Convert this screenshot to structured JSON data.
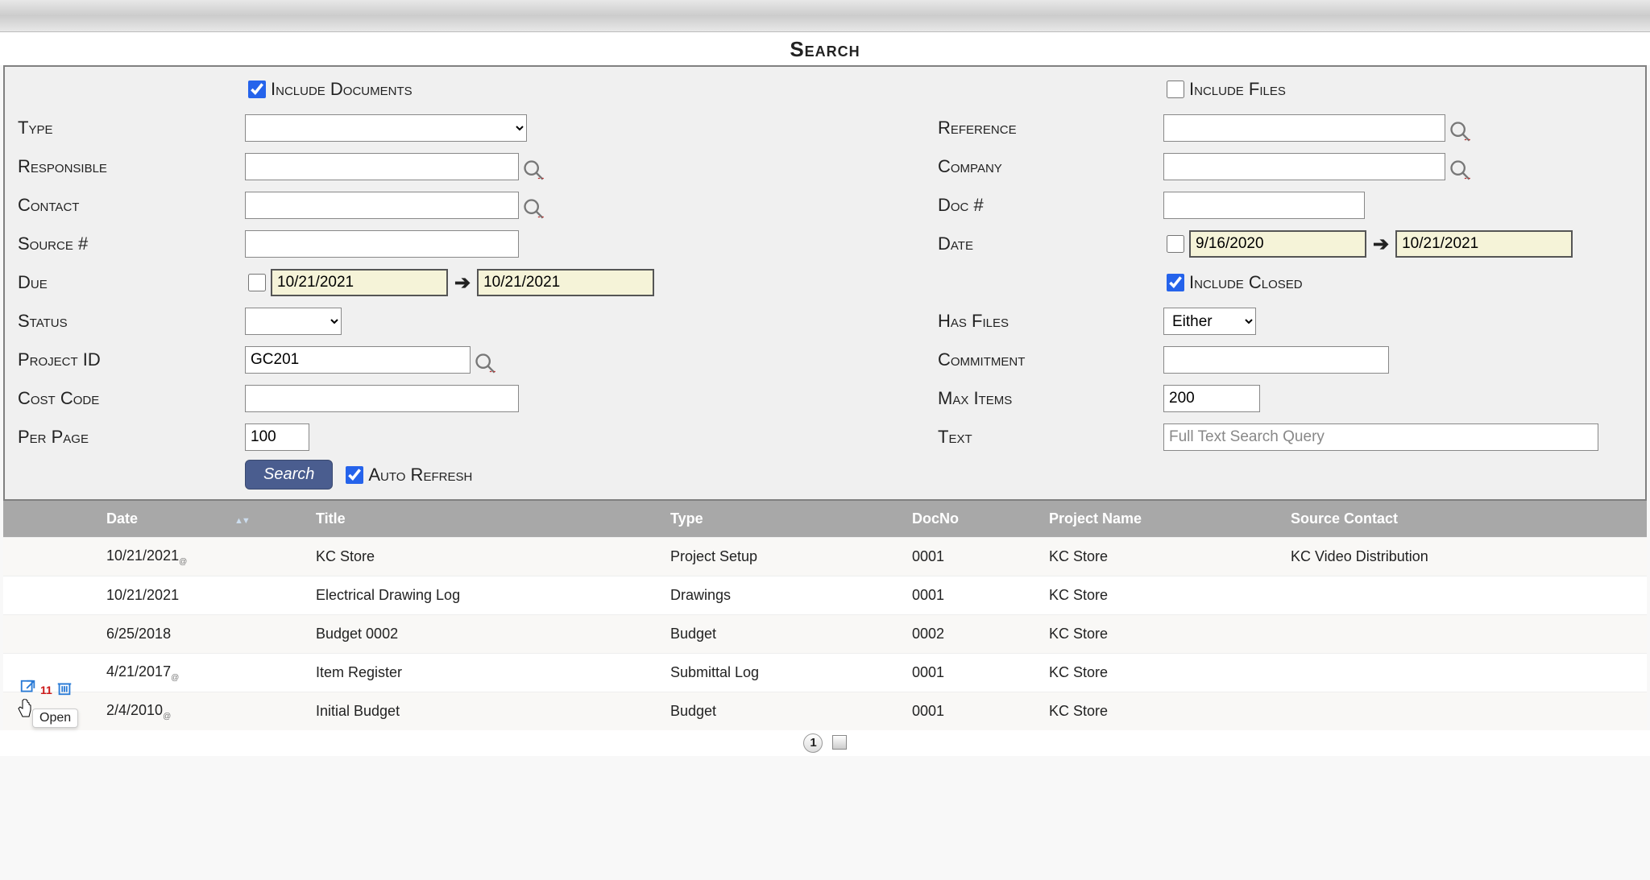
{
  "page": {
    "title": "Search"
  },
  "form": {
    "include_documents": {
      "label": "Include Documents",
      "checked": true
    },
    "include_files": {
      "label": "Include Files",
      "checked": false
    },
    "type": {
      "label": "Type",
      "value": ""
    },
    "reference": {
      "label": "Reference",
      "value": ""
    },
    "responsible": {
      "label": "Responsible",
      "value": ""
    },
    "company": {
      "label": "Company",
      "value": ""
    },
    "contact": {
      "label": "Contact",
      "value": ""
    },
    "doc_no": {
      "label": "Doc #",
      "value": ""
    },
    "source_no": {
      "label": "Source #",
      "value": ""
    },
    "date": {
      "label": "Date",
      "enabled": false,
      "from": "9/16/2020",
      "to": "10/21/2021"
    },
    "due": {
      "label": "Due",
      "enabled": false,
      "from": "10/21/2021",
      "to": "10/21/2021"
    },
    "include_closed": {
      "label": "Include Closed",
      "checked": true
    },
    "status": {
      "label": "Status",
      "value": ""
    },
    "has_files": {
      "label": "Has Files",
      "value": "Either"
    },
    "project_id": {
      "label": "Project ID",
      "value": "GC201"
    },
    "commitment": {
      "label": "Commitment",
      "value": ""
    },
    "cost_code": {
      "label": "Cost Code",
      "value": ""
    },
    "max_items": {
      "label": "Max Items",
      "value": "200"
    },
    "per_page": {
      "label": "Per Page",
      "value": "100"
    },
    "text": {
      "label": "Text",
      "value": "",
      "placeholder": "Full Text Search Query"
    },
    "search_button": "Search",
    "auto_refresh": {
      "label": "Auto Refresh",
      "checked": true
    }
  },
  "results": {
    "columns": {
      "date": "Date",
      "title": "Title",
      "type": "Type",
      "docno": "DocNo",
      "project": "Project Name",
      "contact": "Source Contact"
    },
    "rows": [
      {
        "date": "10/21/2021",
        "has_sub": true,
        "title": "KC Store",
        "type": "Project Setup",
        "docno": "0001",
        "project": "KC Store",
        "contact": "KC Video Distribution"
      },
      {
        "date": "10/21/2021",
        "has_sub": false,
        "title": "Electrical Drawing Log",
        "type": "Drawings",
        "docno": "0001",
        "project": "KC Store",
        "contact": ""
      },
      {
        "date": "6/25/2018",
        "has_sub": false,
        "title": "Budget 0002",
        "type": "Budget",
        "docno": "0002",
        "project": "KC Store",
        "contact": ""
      },
      {
        "date": "4/21/2017",
        "has_sub": true,
        "title": "Item Register",
        "type": "Submittal Log",
        "docno": "0001",
        "project": "KC Store",
        "contact": ""
      },
      {
        "date": "2/4/2010",
        "has_sub": true,
        "title": "Initial Budget",
        "type": "Budget",
        "docno": "0001",
        "project": "KC Store",
        "contact": ""
      }
    ]
  },
  "hover": {
    "tooltip": "Open",
    "badge": "11"
  },
  "pager": {
    "current": "1"
  }
}
